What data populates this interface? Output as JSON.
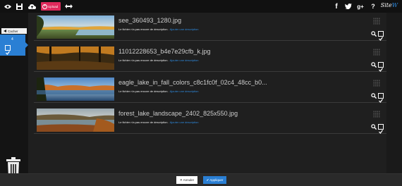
{
  "topbar": {
    "upload_label": "Upload",
    "logo_main": "Site",
    "logo_accent": "W",
    "icons": [
      "eye-icon",
      "save-icon",
      "cloud-upload-icon",
      "arrows-icon",
      "facebook-icon",
      "twitter-icon",
      "google-plus-icon",
      "help-icon"
    ],
    "right_labels": {
      "facebook": "f",
      "googleplus": "g+",
      "help": "?"
    }
  },
  "sidebar": {
    "hide_label": "Cacher",
    "selected_count": "4"
  },
  "images": [
    {
      "name": "see_360493_1280.jpg",
      "description": "Le fichier n'a pas encore de description.",
      "add_link": "Ajouter une description"
    },
    {
      "name": "11012228653_b4e7e29cfb_k.jpg",
      "description": "Le fichier n'a pas encore de description.",
      "add_link": "Ajouter une description"
    },
    {
      "name": "eagle_lake_in_fall_colors_c8c1fc0f_02c4_48cc_b0...",
      "description": "Le fichier n'a pas encore de description.",
      "add_link": "Ajouter une description"
    },
    {
      "name": "forest_lake_landscape_2402_825x550.jpg",
      "description": "Le fichier n'a pas encore de description.",
      "add_link": "Ajouter une description"
    }
  ],
  "footer": {
    "cancel_label": "Annuler",
    "apply_label": "Appliquer"
  },
  "colors": {
    "accent": "#2a7fd4",
    "upload": "#e02a5c",
    "background": "#1f1f1f"
  }
}
